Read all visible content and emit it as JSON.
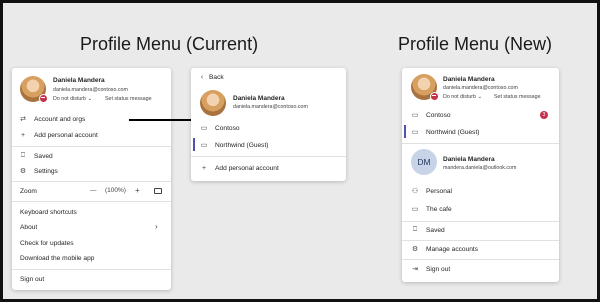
{
  "titles": {
    "current": "Profile Menu (Current)",
    "new": "Profile Menu (New)"
  },
  "current": {
    "name": "Daniela Mandera",
    "email": "daniela.mandera@contoso.com",
    "status": "Do not disturb",
    "set_status": "Set status message",
    "items": {
      "account_orgs": "Account and orgs",
      "add_personal": "Add personal account",
      "saved": "Saved",
      "settings": "Settings",
      "zoom": "Zoom",
      "zoom_value": "(100%)",
      "zoom_minus": "—",
      "zoom_plus": "+",
      "keyboard": "Keyboard shortcuts",
      "about": "About",
      "updates": "Check for updates",
      "download": "Download the mobile app",
      "sign_out": "Sign out"
    }
  },
  "submenu": {
    "back": "Back",
    "name": "Daniela Mandera",
    "email": "daniela.mandera@contoso.com",
    "orgs": [
      "Contoso",
      "Northwind (Guest)"
    ],
    "add_personal": "Add personal account"
  },
  "new_menu": {
    "name": "Daniela Mandera",
    "email": "daniela.mandera@contoso.com",
    "status": "Do not disturb",
    "set_status": "Set status message",
    "orgs": [
      "Contoso",
      "Northwind (Guest)"
    ],
    "contoso_badge": "3",
    "personal_initials": "DM",
    "personal_name": "Daniela Mandera",
    "personal_email": "mandera.daniela@outlook.com",
    "personal_items": [
      "Personal",
      "The cafe"
    ],
    "saved": "Saved",
    "manage": "Manage accounts",
    "sign_out": "Sign out"
  },
  "colors": {
    "accent": "#4f52b2",
    "dnd_red": "#c4314b",
    "badge_red": "#c4314b"
  }
}
